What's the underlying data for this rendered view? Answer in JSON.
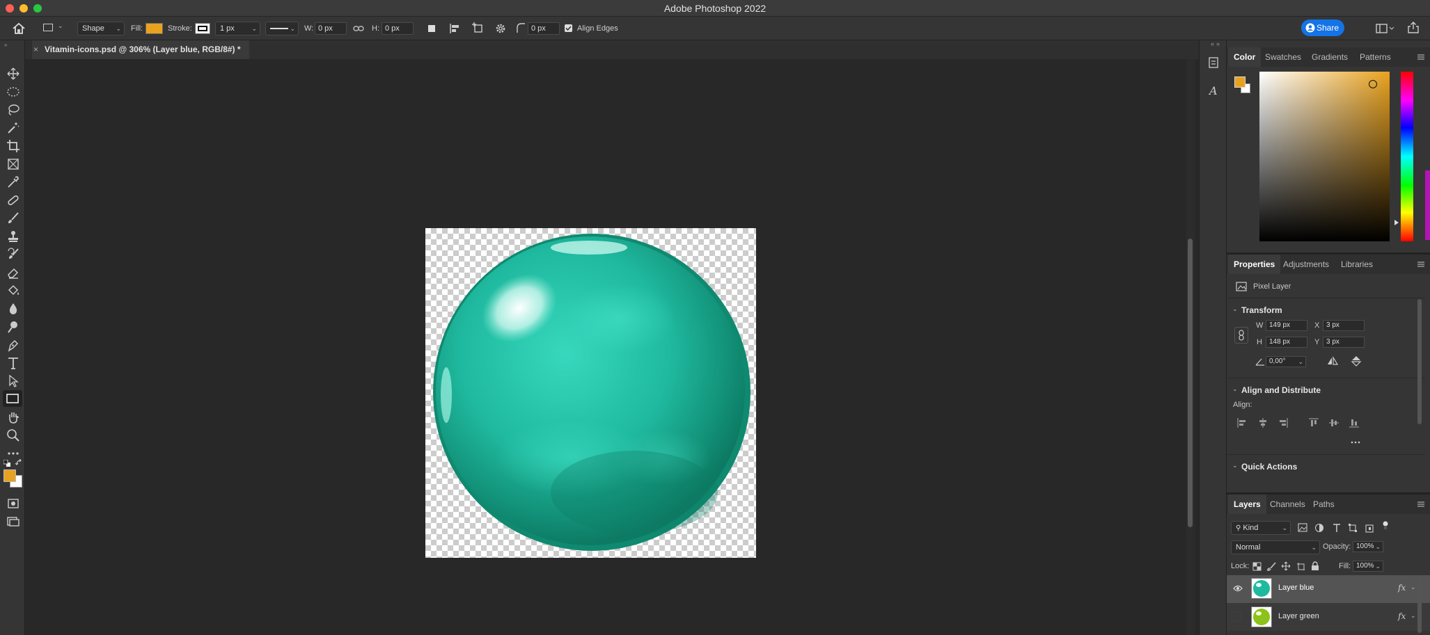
{
  "app": {
    "title": "Adobe Photoshop 2022"
  },
  "options_bar": {
    "mode": "Shape",
    "fill_label": "Fill:",
    "fill_color": "#e9a21f",
    "stroke_label": "Stroke:",
    "stroke_width": "1 px",
    "w_label": "W:",
    "w_value": "0 px",
    "h_label": "H:",
    "h_value": "0 px",
    "radius_value": "0 px",
    "align_edges_label": "Align Edges",
    "share_label": "Share"
  },
  "document": {
    "tab_label": "Vitamin-icons.psd @ 306% (Layer blue, RGB/8#) *"
  },
  "toolbar": {
    "foreground": "#e9a21f",
    "background": "#ffffff"
  },
  "color_panel": {
    "tabs": [
      "Color",
      "Swatches",
      "Gradients",
      "Patterns"
    ],
    "foreground": "#e9a21f"
  },
  "properties_panel": {
    "tabs": [
      "Properties",
      "Adjustments",
      "Libraries"
    ],
    "layer_type": "Pixel Layer",
    "transform_title": "Transform",
    "w_label": "W",
    "w_value": "149 px",
    "h_label": "H",
    "h_value": "148 px",
    "x_label": "X",
    "x_value": "3 px",
    "y_label": "Y",
    "y_value": "3 px",
    "angle_value": "0,00°",
    "align_title": "Align and Distribute",
    "align_label": "Align:",
    "quick_actions_title": "Quick Actions"
  },
  "layers_panel": {
    "tabs": [
      "Layers",
      "Channels",
      "Paths"
    ],
    "filter_kind": "Kind",
    "blend_mode": "Normal",
    "opacity_label": "Opacity:",
    "opacity_value": "100%",
    "lock_label": "Lock:",
    "fill_label": "Fill:",
    "fill_value": "100%",
    "layers": [
      {
        "name": "Layer blue",
        "fx": "fx",
        "selected": true,
        "visible": true
      },
      {
        "name": "Layer green",
        "fx": "fx",
        "selected": false,
        "visible": false
      }
    ]
  }
}
